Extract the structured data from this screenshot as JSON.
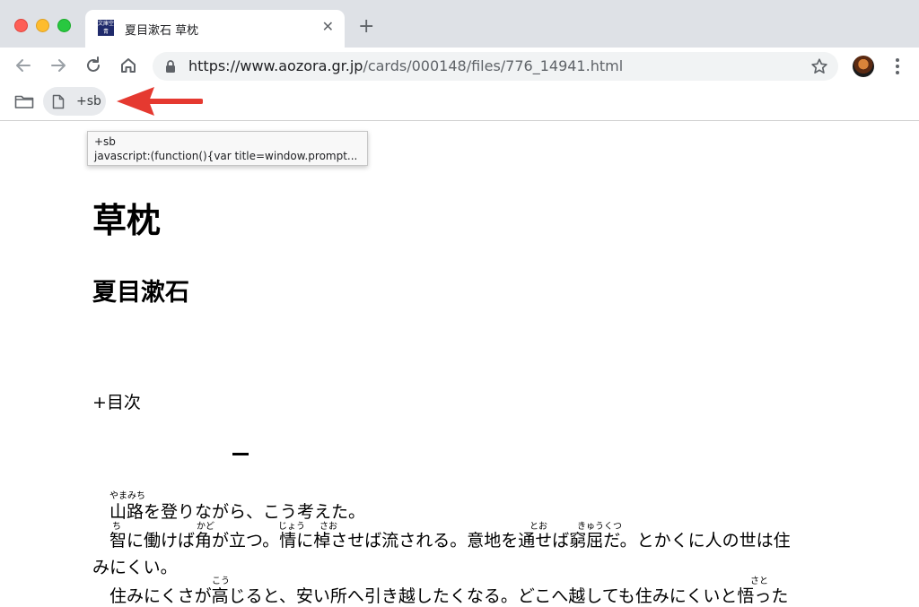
{
  "browser": {
    "tab": {
      "favicon_text": "文庫空青",
      "title": "夏目漱石 草枕"
    },
    "url": {
      "scheme_host": "https://www.aozora.gr.jp",
      "path": "/cards/000148/files/776_14941.html"
    },
    "bookmarks": [
      {
        "label": "+sb"
      }
    ],
    "tooltip": {
      "line1": "+sb",
      "line2": "javascript:(function(){var title=window.prompt..."
    },
    "colors": {
      "tabstrip": "#dee1e6",
      "annotation_arrow": "#e53930"
    }
  },
  "page": {
    "title": "草枕",
    "author": "夏目漱石",
    "toc": "+目次",
    "chapter": "一",
    "lines": [
      {
        "text": "山路を登りながら、こう考えた。"
      },
      {
        "text": "智に働けば角が立つ。情に棹させば流される。意地を通せば窮屈だ。とかくに人の世は住"
      },
      {
        "text": "みにくい。"
      },
      {
        "text": "住みにくさが高じると、安い所へ引き越したくなる。どこへ越しても住みにくいと悟った"
      }
    ],
    "ruby": [
      {
        "text": "やまみち"
      },
      {
        "text": "ち"
      },
      {
        "text": "かど"
      },
      {
        "text": "じょう"
      },
      {
        "text": "さお"
      },
      {
        "text": "とお"
      },
      {
        "text": "きゅうくつ"
      },
      {
        "text": "こう"
      },
      {
        "text": "さと"
      }
    ]
  }
}
